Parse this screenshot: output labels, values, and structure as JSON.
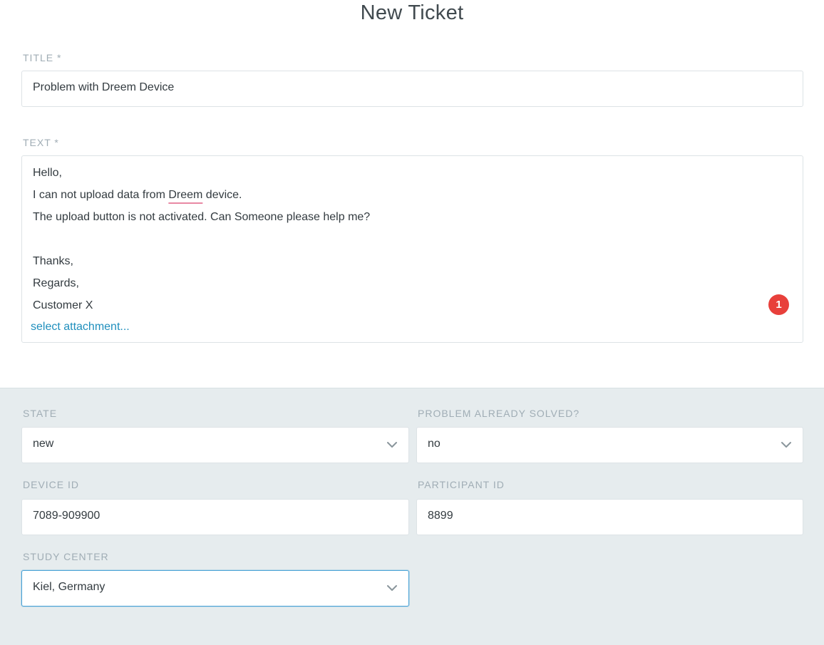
{
  "heading": "New Ticket",
  "title_field": {
    "label": "TITLE *",
    "value": "Problem with Dreem Device"
  },
  "text_field": {
    "label": "TEXT *",
    "lines": [
      "Hello,",
      "I can not upload data from ",
      "Dreem",
      " device.",
      "The upload button is not activated. Can Someone please help me?",
      "",
      "Thanks,",
      "Regards,",
      "Customer X"
    ],
    "attachment_link": "select attachment...",
    "badge_count": "1",
    "badge_color": "#e8403b"
  },
  "attributes": {
    "state": {
      "label": "STATE",
      "value": "new"
    },
    "problem_solved": {
      "label": "PROBLEM ALREADY SOLVED?",
      "value": "no"
    },
    "device_id": {
      "label": "DEVICE ID",
      "value": "7089-909900"
    },
    "participant_id": {
      "label": "PARTICIPANT ID",
      "value": "8899"
    },
    "study_center": {
      "label": "STUDY CENTER",
      "value": "Kiel, Germany"
    }
  },
  "colors": {
    "panel_background": "#e6ecee",
    "link": "#1f8fbd",
    "focus_border": "#4aa3d6"
  },
  "icons": {
    "select_chevron": "chevron-down-icon"
  }
}
